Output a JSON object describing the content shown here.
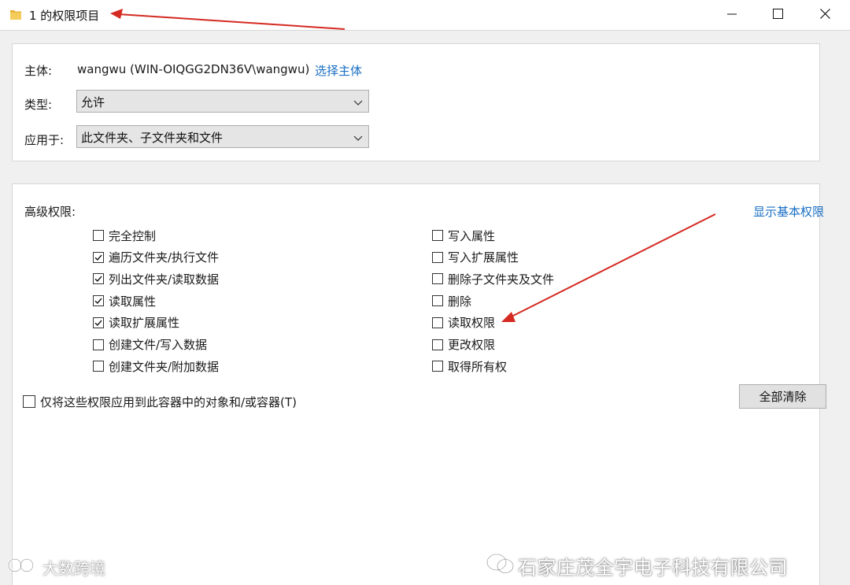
{
  "window": {
    "title": "1 的权限项目"
  },
  "principal": {
    "label": "主体:",
    "value": "wangwu (WIN-OIQGG2DN36V\\wangwu)",
    "select_link": "选择主体"
  },
  "type_field": {
    "label": "类型:",
    "value": "允许"
  },
  "applies_field": {
    "label": "应用于:",
    "value": "此文件夹、子文件夹和文件"
  },
  "advanced": {
    "label": "高级权限:",
    "show_basic_link": "显示基本权限",
    "left_permissions": [
      {
        "label": "完全控制",
        "checked": false
      },
      {
        "label": "遍历文件夹/执行文件",
        "checked": true
      },
      {
        "label": "列出文件夹/读取数据",
        "checked": true
      },
      {
        "label": "读取属性",
        "checked": true
      },
      {
        "label": "读取扩展属性",
        "checked": true
      },
      {
        "label": "创建文件/写入数据",
        "checked": false
      },
      {
        "label": "创建文件夹/附加数据",
        "checked": false
      }
    ],
    "right_permissions": [
      {
        "label": "写入属性",
        "checked": false
      },
      {
        "label": "写入扩展属性",
        "checked": false
      },
      {
        "label": "删除子文件夹及文件",
        "checked": false
      },
      {
        "label": "删除",
        "checked": false
      },
      {
        "label": "读取权限",
        "checked": false
      },
      {
        "label": "更改权限",
        "checked": false
      },
      {
        "label": "取得所有权",
        "checked": false
      }
    ],
    "apply_only_label": "仅将这些权限应用到此容器中的对象和/或容器(T)",
    "apply_only_checked": false,
    "clear_all_button": "全部清除"
  },
  "watermarks": {
    "left": "大数跨境",
    "right": "石家庄茂全宇电子科技有限公司"
  },
  "colors": {
    "link": "#1a6fc4",
    "annotation_arrow": "#d42a22",
    "folder": "#e8b43a"
  }
}
